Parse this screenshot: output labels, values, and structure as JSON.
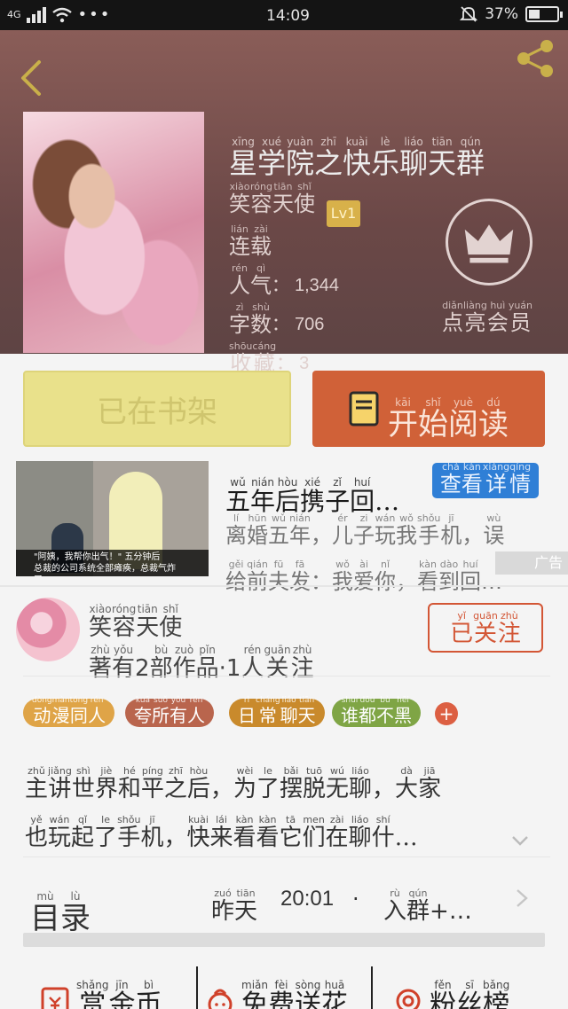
{
  "status_bar": {
    "network": "4G",
    "time": "14:09",
    "battery": "37%"
  },
  "header": {
    "title": {
      "hz": [
        "星",
        "学",
        "院",
        "之",
        "快",
        "乐",
        "聊",
        "天",
        "群"
      ],
      "py": [
        "xīng",
        "xué",
        "yuàn",
        "zhī",
        "kuài",
        "lè",
        "liáo",
        "tiān",
        "qún"
      ]
    },
    "author": {
      "hz": [
        "笑",
        "容",
        "天",
        "使"
      ],
      "py": [
        "xiào",
        "róng",
        "tiān",
        "shǐ"
      ]
    },
    "level": "Lv1",
    "status": {
      "hz": [
        "连",
        "载"
      ],
      "py": [
        "lián",
        "zài"
      ]
    },
    "popularity": {
      "label_hz": [
        "人",
        "气"
      ],
      "label_py": [
        "rén",
        "qì"
      ],
      "colon": "：",
      "value": "1,344"
    },
    "word_count": {
      "label_hz": [
        "字",
        "数"
      ],
      "label_py": [
        "zì",
        "shù"
      ],
      "colon": "：",
      "value": "706"
    },
    "favorites": {
      "label_hz": [
        "收",
        "藏"
      ],
      "label_py": [
        "shōu",
        "cáng"
      ],
      "colon": "：",
      "value": "3"
    },
    "vip": {
      "hz": [
        "点",
        "亮",
        "会",
        "员"
      ],
      "py": [
        "diǎn",
        "liàng",
        "huì",
        "yuán"
      ]
    }
  },
  "actions": {
    "shelf_label": "已在书架",
    "read": {
      "hz": [
        "开",
        "始",
        "阅",
        "读"
      ],
      "py": [
        "kāi",
        "shǐ",
        "yuè",
        "dú"
      ]
    }
  },
  "ad": {
    "image_caption_1": "\"阿姨，我帮你出气！\" 五分钟后",
    "image_caption_2": "总裁的公司系统全部瘫痪，总裁气炸了…",
    "title": {
      "hz": [
        "五",
        "年",
        "后",
        "携",
        "子",
        "回",
        "…"
      ],
      "py": [
        "wǔ",
        "nián",
        "hòu",
        "xié",
        "zǐ",
        "huí",
        ""
      ]
    },
    "detail": {
      "hz": [
        "查",
        "看",
        "详",
        "情"
      ],
      "py": [
        "chá",
        "kàn",
        "xiáng",
        "qíng"
      ]
    },
    "desc1": {
      "hz": [
        "离",
        "婚",
        "五",
        "年",
        "，",
        "儿",
        "子",
        "玩",
        "我",
        "手",
        "机",
        "，",
        "误"
      ],
      "py": [
        "lí",
        "hūn",
        "wǔ",
        "nián",
        "",
        "ér",
        "zi",
        "wán",
        "wǒ",
        "shǒu",
        "jī",
        "",
        "wù"
      ]
    },
    "desc2": {
      "hz": [
        "给",
        "前",
        "夫",
        "发",
        "：",
        "我",
        "爱",
        "你",
        "，",
        "看",
        "到",
        "回",
        "…"
      ],
      "py": [
        "gěi",
        "qián",
        "fū",
        "fā",
        "",
        "wǒ",
        "ài",
        "nǐ",
        "",
        "kàn",
        "dào",
        "huí",
        ""
      ]
    },
    "tag": "广告"
  },
  "author_card": {
    "name": {
      "hz": [
        "笑",
        "容",
        "天",
        "使"
      ],
      "py": [
        "xiào",
        "róng",
        "tiān",
        "shǐ"
      ]
    },
    "stats": {
      "hz": [
        "著",
        "有",
        "2",
        "部",
        "作",
        "品",
        "·",
        "1",
        "人",
        "关",
        "注"
      ],
      "py": [
        "zhù",
        "yǒu",
        "",
        "bù",
        "zuò",
        "pǐn",
        "",
        "",
        "rén",
        "guān",
        "zhù"
      ]
    },
    "follow": {
      "hz": [
        "已",
        "关",
        "注"
      ],
      "py": [
        "yǐ",
        "guān",
        "zhù"
      ]
    }
  },
  "tags": [
    {
      "hz": [
        "动",
        "漫",
        "同",
        "人"
      ],
      "py": [
        "dòng",
        "màn",
        "tóng",
        "rén"
      ],
      "color": "#dfa447"
    },
    {
      "hz": [
        "夸",
        "所",
        "有",
        "人"
      ],
      "py": [
        "kuā",
        "suǒ",
        "yǒu",
        "rén"
      ],
      "color": "#b9654d"
    },
    {
      "hz": [
        "日",
        "常",
        "聊",
        "天"
      ],
      "py": [
        "rì",
        "cháng",
        "liáo",
        "tiān"
      ],
      "color": "#c98a2c"
    },
    {
      "hz": [
        "谁",
        "都",
        "不",
        "黑"
      ],
      "py": [
        "shuí",
        "dōu",
        "bù",
        "hēi"
      ],
      "color": "#7fa545"
    }
  ],
  "tag_plus": "+",
  "summary": {
    "line1": {
      "hz": [
        "主",
        "讲",
        "世",
        "界",
        "和",
        "平",
        "之",
        "后",
        "，",
        "为",
        "了",
        "摆",
        "脱",
        "无",
        "聊",
        "，",
        "大",
        "家"
      ],
      "py": [
        "zhǔ",
        "jiǎng",
        "shì",
        "jiè",
        "hé",
        "píng",
        "zhī",
        "hòu",
        "",
        "wèi",
        "le",
        "bǎi",
        "tuō",
        "wú",
        "liáo",
        "",
        "dà",
        "jiā"
      ]
    },
    "line2": {
      "hz": [
        "也",
        "玩",
        "起",
        "了",
        "手",
        "机",
        "，",
        "快",
        "来",
        "看",
        "看",
        "它",
        "们",
        "在",
        "聊",
        "什",
        "…"
      ],
      "py": [
        "yě",
        "wán",
        "qǐ",
        "le",
        "shǒu",
        "jī",
        "",
        "kuài",
        "lái",
        "kàn",
        "kàn",
        "tā",
        "men",
        "zài",
        "liáo",
        "shí",
        ""
      ]
    }
  },
  "toc": {
    "label": {
      "hz": [
        "目",
        "录"
      ],
      "py": [
        "mù",
        "lù"
      ]
    },
    "day": {
      "hz": [
        "昨",
        "天"
      ],
      "py": [
        "zuó",
        "tiān"
      ]
    },
    "time": "20:01",
    "dot": "·",
    "chapter": {
      "hz": [
        "入",
        "群",
        "+",
        "…"
      ],
      "py": [
        "rù",
        "qún",
        "",
        ""
      ]
    }
  },
  "bottom_tabs": [
    {
      "hz": [
        "赏",
        "金",
        "币"
      ],
      "py": [
        "shǎng",
        "jīn",
        "bì"
      ],
      "icon": "coin-envelope-icon"
    },
    {
      "hz": [
        "免",
        "费",
        "送",
        "花"
      ],
      "py": [
        "miǎn",
        "fèi",
        "sòng",
        "huā"
      ],
      "icon": "flower-icon"
    },
    {
      "hz": [
        "粉",
        "丝",
        "榜"
      ],
      "py": [
        "fěn",
        "sī",
        "bǎng"
      ],
      "icon": "medal-icon"
    }
  ],
  "colors": {
    "accent": "#d06138",
    "header_bg": "#6b4847",
    "blue": "#2f7fd6",
    "follow_red": "#d35635"
  }
}
